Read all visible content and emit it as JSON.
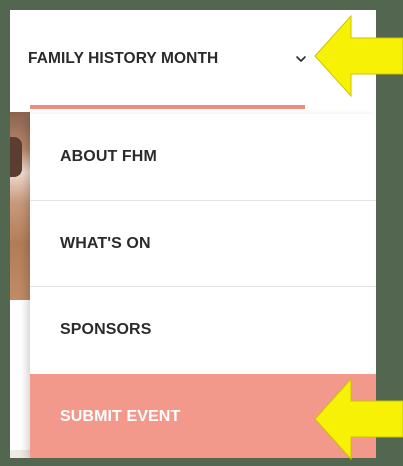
{
  "nav": {
    "title": "FAMILY HISTORY MONTH",
    "chevron_icon": "chevron-down-icon"
  },
  "menu": {
    "items": [
      {
        "label": "ABOUT FHM",
        "active": false
      },
      {
        "label": "WHAT'S ON",
        "active": false
      },
      {
        "label": "SPONSORS",
        "active": false
      },
      {
        "label": "SUBMIT EVENT",
        "active": true
      }
    ]
  },
  "annotations": {
    "arrow_color": "#f7f205",
    "arrow_icon": "arrow-left-icon"
  },
  "colors": {
    "background": "#526650",
    "accent": "#ee8a7f",
    "active_item": "#f2998c"
  }
}
